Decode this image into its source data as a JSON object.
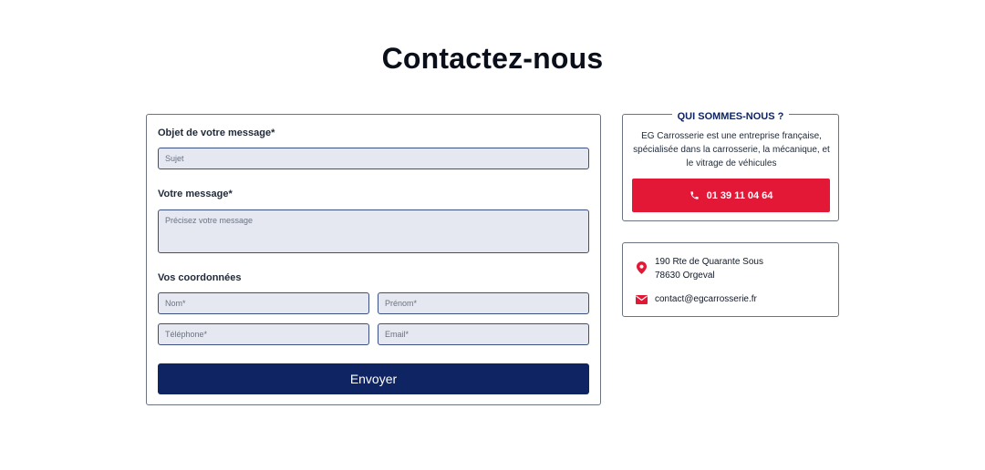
{
  "page": {
    "title": "Contactez-nous"
  },
  "form": {
    "subject_label": "Objet de votre message*",
    "subject_placeholder": "Sujet",
    "message_label": "Votre message*",
    "message_placeholder": "Précisez votre message",
    "contact_label": "Vos coordonnées",
    "lastname_placeholder": "Nom*",
    "firstname_placeholder": "Prénom*",
    "phone_placeholder": "Téléphone*",
    "email_placeholder": "Email*",
    "submit_label": "Envoyer"
  },
  "about": {
    "title": "QUI SOMMES-NOUS ?",
    "text": "EG Carrosserie est une entreprise française, spécialisée dans la carrosserie, la mécanique, et le vitrage de véhicules",
    "phone": "01 39 11 04 64"
  },
  "info": {
    "address_line1": "190 Rte de Quarante Sous",
    "address_line2": "78630 Orgeval",
    "email": "contact@egcarrosserie.fr"
  },
  "colors": {
    "primary_navy": "#0f2463",
    "accent_red": "#e31837",
    "field_bg": "#e5e8f0"
  },
  "icons": {
    "phone": "phone-icon",
    "location": "map-pin-icon",
    "mail": "mail-icon"
  }
}
